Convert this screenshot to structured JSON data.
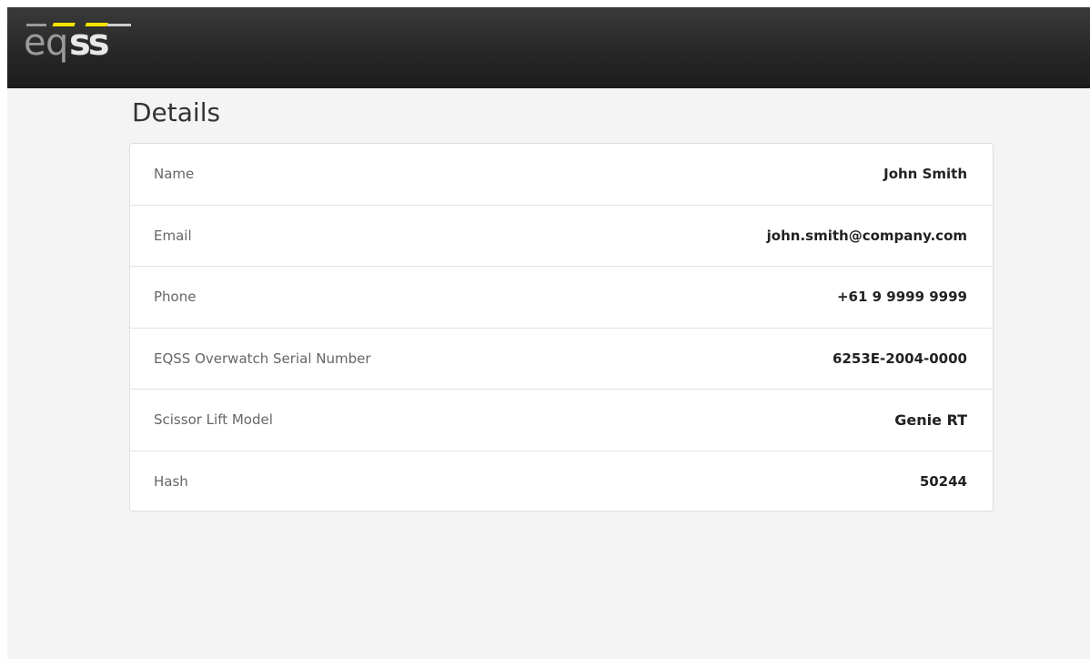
{
  "header": {
    "logo_text": "eqss",
    "colors": {
      "background": "#262626",
      "logo_e": "#9a9a9a",
      "logo_q": "#9a9a9a",
      "logo_ss": "#e8e8e8",
      "accent": "#f2e600"
    }
  },
  "page": {
    "title": "Details"
  },
  "details": {
    "rows": [
      {
        "label": "Name",
        "value": "John Smith"
      },
      {
        "label": "Email",
        "value": "john.smith@company.com"
      },
      {
        "label": "Phone",
        "value": "+61 9 9999 9999"
      },
      {
        "label": "EQSS Overwatch Serial Number",
        "value": "6253E-2004-0000"
      },
      {
        "label": "Scissor Lift Model",
        "value": "Genie RT"
      },
      {
        "label": "Hash",
        "value": "50244"
      }
    ]
  }
}
